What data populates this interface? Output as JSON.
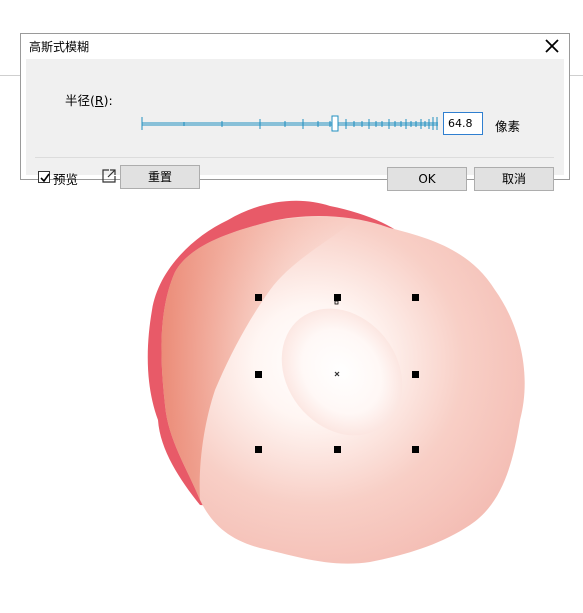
{
  "dialog": {
    "title": "高斯式模糊",
    "radius_label_prefix": "半径",
    "radius_label_key": "R",
    "radius_label_suffix": "):",
    "radius_value": "64.8",
    "radius_unit": "像素",
    "preview_label": "预览",
    "preview_checked": true,
    "reset_label": "重置",
    "ok_label": "OK",
    "cancel_label": "取消"
  },
  "colors": {
    "slider": "#1f8fc0",
    "shape_back": "#e85a68",
    "shape_front_edge": "#e8826a",
    "shape_glow_center": "#ffffff",
    "handle": "#000000"
  }
}
